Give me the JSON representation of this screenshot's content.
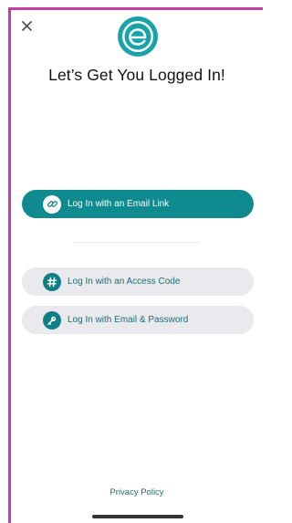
{
  "header": {
    "title": "Let’s Get You Logged In!"
  },
  "actions": {
    "email_link_label": "Log In with an Email Link",
    "access_code_label": "Log In with an Access Code",
    "email_password_label": "Log In with Email & Password"
  },
  "footer": {
    "privacy_label": "Privacy Policy"
  },
  "icons": {
    "close": "close-icon",
    "logo": "e-logo-icon",
    "email_link": "link-icon",
    "access_code": "hash-icon",
    "email_password": "key-icon"
  },
  "colors": {
    "accent": "#0f8a8f",
    "accent_text": "#1a6f78",
    "secondary_button_bg": "#e9e9ee",
    "frame_border": "#c43ea6"
  }
}
